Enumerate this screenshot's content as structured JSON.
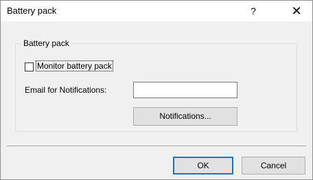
{
  "window": {
    "title": "Battery pack",
    "help_glyph": "?",
    "close_glyph": "✕"
  },
  "group": {
    "legend": "Battery pack",
    "monitor_checkbox": {
      "label": "Monitor battery pack",
      "checked": false
    },
    "email": {
      "label": "Email for Notifications:",
      "value": "",
      "placeholder": ""
    },
    "notifications_button": "Notifications..."
  },
  "footer": {
    "ok_label": "OK",
    "cancel_label": "Cancel"
  },
  "colors": {
    "focus_border": "#0078d7",
    "dialog_background": "#f0f0f0"
  },
  "icons": {
    "help": "question-mark-icon",
    "close": "close-icon"
  }
}
